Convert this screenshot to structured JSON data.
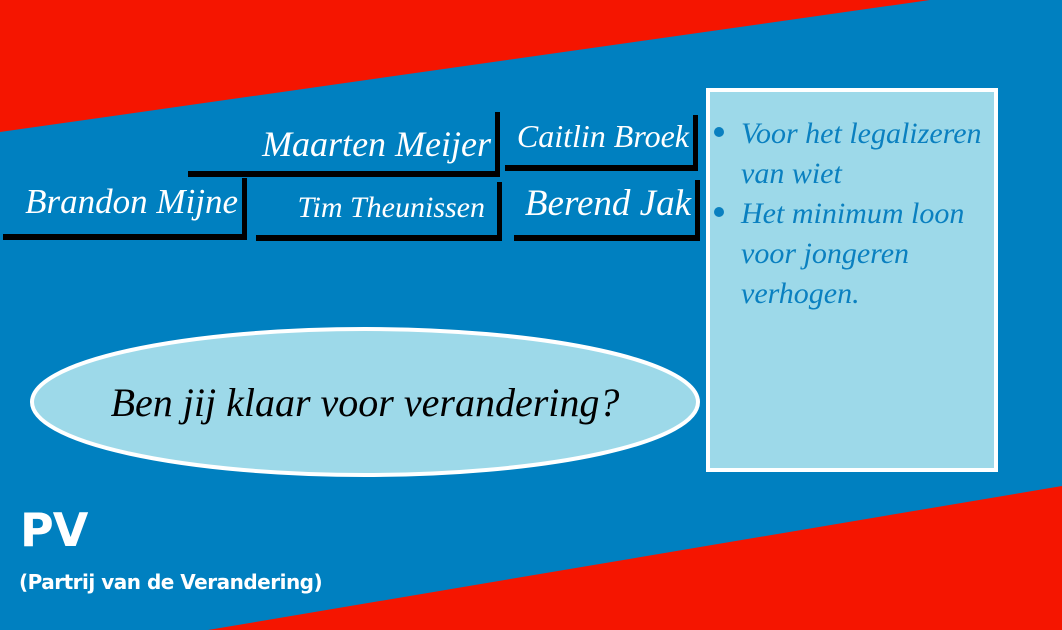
{
  "colors": {
    "background": "#0080c0",
    "accent_red": "#f51500",
    "panel": "#9dd9e9"
  },
  "candidates": [
    "Maarten Meijer",
    "Caitlin Broek",
    "Brandon Mijne",
    "Tim Theunissen",
    "Berend Jak"
  ],
  "slogan": "Ben jij klaar voor verandering?",
  "points": [
    "Voor het legalizeren van wiet",
    "Het minimum loon voor jongeren verhogen."
  ],
  "party": {
    "abbr": "PV",
    "full_name": "(Partrij van de Verandering)"
  }
}
